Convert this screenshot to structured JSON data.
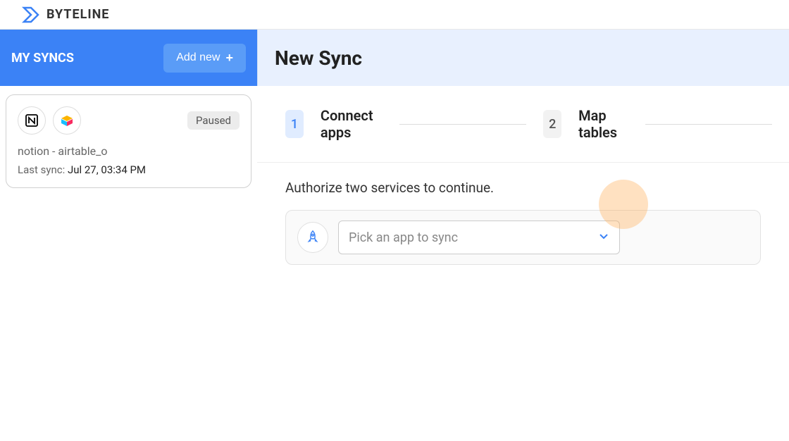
{
  "brand": "BYTELINE",
  "sidebar": {
    "title": "MY SYNCS",
    "add_button": "Add new"
  },
  "sync_card": {
    "status": "Paused",
    "name": "notion - airtable_o",
    "last_sync_label": "Last sync:",
    "last_sync_value": "Jul 27, 03:34 PM"
  },
  "main": {
    "title": "New Sync",
    "steps": [
      {
        "num": "1",
        "label": "Connect apps"
      },
      {
        "num": "2",
        "label": "Map tables"
      }
    ],
    "instruction": "Authorize two services to continue.",
    "picker_placeholder": "Pick an app to sync"
  }
}
